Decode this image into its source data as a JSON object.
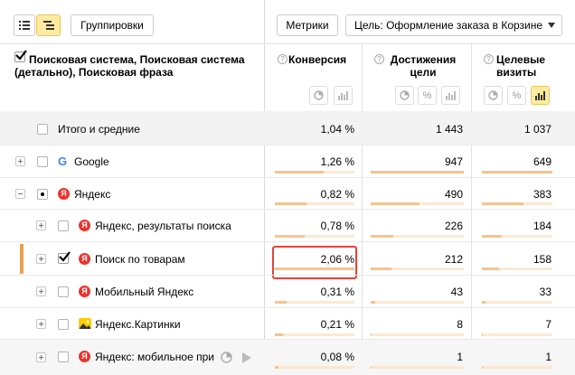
{
  "toolbar": {
    "groupings_label": "Группировки",
    "metrics_label": "Метрики",
    "goal_label": "Цель: Оформление заказа в Корзине"
  },
  "header": {
    "dimension_title": "Поисковая система, Поисковая система (детально), Поисковая фраза",
    "columns": [
      {
        "label": "Конверсия"
      },
      {
        "label": "Достижения цели"
      },
      {
        "label": "Целевые визиты"
      }
    ]
  },
  "rows": [
    {
      "label": "Итого и средние",
      "conversion": "1,04 %",
      "achievements": "1 443",
      "visits": "1 037"
    },
    {
      "label": "Google",
      "conversion": "1,26 %",
      "achievements": "947",
      "visits": "649"
    },
    {
      "label": "Яндекс",
      "conversion": "0,82 %",
      "achievements": "490",
      "visits": "383"
    },
    {
      "label": "Яндекс, результаты поиска",
      "conversion": "0,78 %",
      "achievements": "226",
      "visits": "184"
    },
    {
      "label": "Поиск по товарам",
      "conversion": "2,06 %",
      "achievements": "212",
      "visits": "158"
    },
    {
      "label": "Мобильный Яндекс",
      "conversion": "0,31 %",
      "achievements": "43",
      "visits": "33"
    },
    {
      "label": "Яндекс.Картинки",
      "conversion": "0,21 %",
      "achievements": "8",
      "visits": "7"
    },
    {
      "label": "Яндекс: мобильное прил",
      "conversion": "0,08 %",
      "achievements": "1",
      "visits": "1"
    }
  ],
  "bars": {
    "conversion": [
      0.61,
      0.4,
      0.38,
      1.0,
      0.15,
      0.1,
      0.04
    ],
    "achievements": [
      1.0,
      0.52,
      0.24,
      0.22,
      0.05,
      0.01,
      0.003
    ],
    "visits": [
      1.0,
      0.59,
      0.28,
      0.24,
      0.05,
      0.01,
      0.003
    ]
  },
  "colors": {
    "accent": "#ffeba0",
    "bar": "#f6c48d",
    "bar_bg": "#fce8d3",
    "highlight_box": "#e0463f",
    "yandex_red": "#f0312b",
    "row_marker": "#e6a35a"
  },
  "icons": {
    "list_view": "list-icon",
    "tree_view": "tree-icon",
    "google": "google-logo-icon",
    "yandex": "yandex-logo-icon",
    "images": "image-icon",
    "pie": "pie-chart-icon",
    "percent": "percent-icon",
    "bars": "bar-chart-icon",
    "help": "question-icon",
    "play": "play-icon"
  }
}
